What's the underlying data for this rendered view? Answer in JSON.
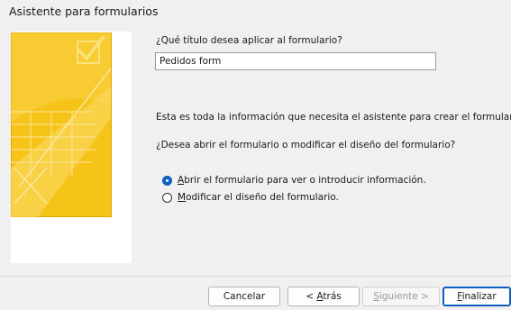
{
  "window": {
    "title": "Asistente para formularios"
  },
  "form": {
    "title_prompt": "¿Qué título desea aplicar al formulario?",
    "title_value": "Pedidos form",
    "info_text": "Esta es toda la información que necesita el asistente para crear el formulario.",
    "question": "¿Desea abrir el formulario o modificar el diseño del formulario?",
    "options": [
      {
        "prefix": "",
        "accel": "A",
        "rest": "brir el formulario para ver o introducir información.",
        "selected": true
      },
      {
        "prefix": "",
        "accel": "M",
        "rest": "odificar el diseño del formulario.",
        "selected": false
      }
    ]
  },
  "buttons": {
    "cancel": "Cancelar",
    "back": {
      "prefix": "< ",
      "accel": "A",
      "rest": "trás"
    },
    "next": {
      "prefix": "",
      "accel": "S",
      "rest": "iguiente >"
    },
    "finish": {
      "prefix": "",
      "accel": "F",
      "rest": "inalizar"
    }
  },
  "colors": {
    "accent": "#0f5fc2",
    "art_yellow": "#f5c518",
    "art_border": "#e0a800"
  }
}
